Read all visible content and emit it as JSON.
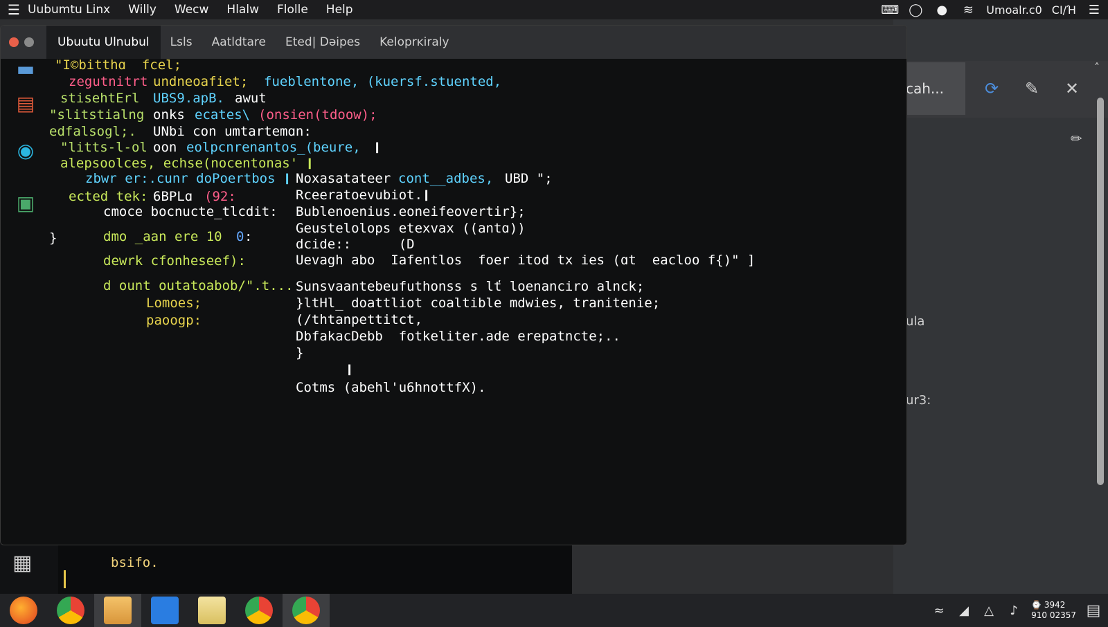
{
  "topbar": {
    "menu_items": [
      "Uubumtu Linx",
      "Willy",
      "Wecw",
      "Hlalw",
      "Flolle",
      "Help"
    ],
    "status_text": "Umoalr.c0",
    "status_text2": "CI/Ή"
  },
  "window": {
    "tabs": [
      "Ubuutu Ulnubul",
      "Lsls",
      "Aatldtare",
      "Eted|  Dəipes",
      "Keloprĸiraly"
    ]
  },
  "code": {
    "left": [
      "\"I©bitthɑ  fcel;",
      "zegutnitrt",
      "stisehtErl",
      "\"slitstialng",
      "edfalsogl;.",
      "\"litts-l-ol",
      "alepsoolces, echse(nocentonas' ❙",
      "zbwr er:.cunr doPoertbos ❙",
      "ected tek:",
      "cmoce bocnucte_tlcdit:",
      "}",
      "dmo _aan ere 10",
      "dewrk cfonheseef):",
      "d ount outatoabob/\".t...",
      "Lomoes;",
      "paoogp:"
    ],
    "mid": [
      "undneoafiet;",
      "UBS9.apB.",
      "onks",
      "UNbi con umtartemɑn:",
      "oon",
      "6BPLɑ"
    ],
    "mid2": [
      "fueblentone, (kuersf.stuented,",
      "awut",
      "ecates\\",
      "(onsien(tdoow);",
      "eolpcnrenantos_(beure,",
      "❙",
      "(92:",
      "0",
      ":"
    ],
    "right": [
      "Noxasatateer",
      "cont__adbes,",
      "UBD \";",
      "Rceeratoevubiot.❙",
      "Bublenoenius.eoneifeovertir};",
      "Geustelolops etexvax ((antɑ))",
      "dcide::      (D",
      "Uevagh abo  Iafentlos  foer itod tх ies (ɑt  eacloo f{)\" ]",
      "Sunsvaantebeufuthonss s lť loenanciro alnck;",
      "}ltHl_ doattliot coaltible mdwies, tranitenie;",
      "(/thtanpettitct,",
      "DbfakacDebb  fotkeliter.ade erepatncte;..",
      "}",
      "❙",
      "Cotms (abehl'u6hnottfX)."
    ]
  },
  "bgpane": {
    "search_tab": "cah...",
    "frag1": "ula",
    "frag2": "ur3:"
  },
  "bgterm": {
    "line": "bsifo."
  },
  "taskbar": {
    "clock_line1": "⌚ 3942",
    "clock_line2": "910 02357"
  },
  "icons": {
    "menu": "hamburger-icon",
    "close_glyph": "✕",
    "refresh_glyph": "⟳",
    "edit_glyph": "✎",
    "pencil_glyph": "✏",
    "up_glyph": "˄"
  }
}
